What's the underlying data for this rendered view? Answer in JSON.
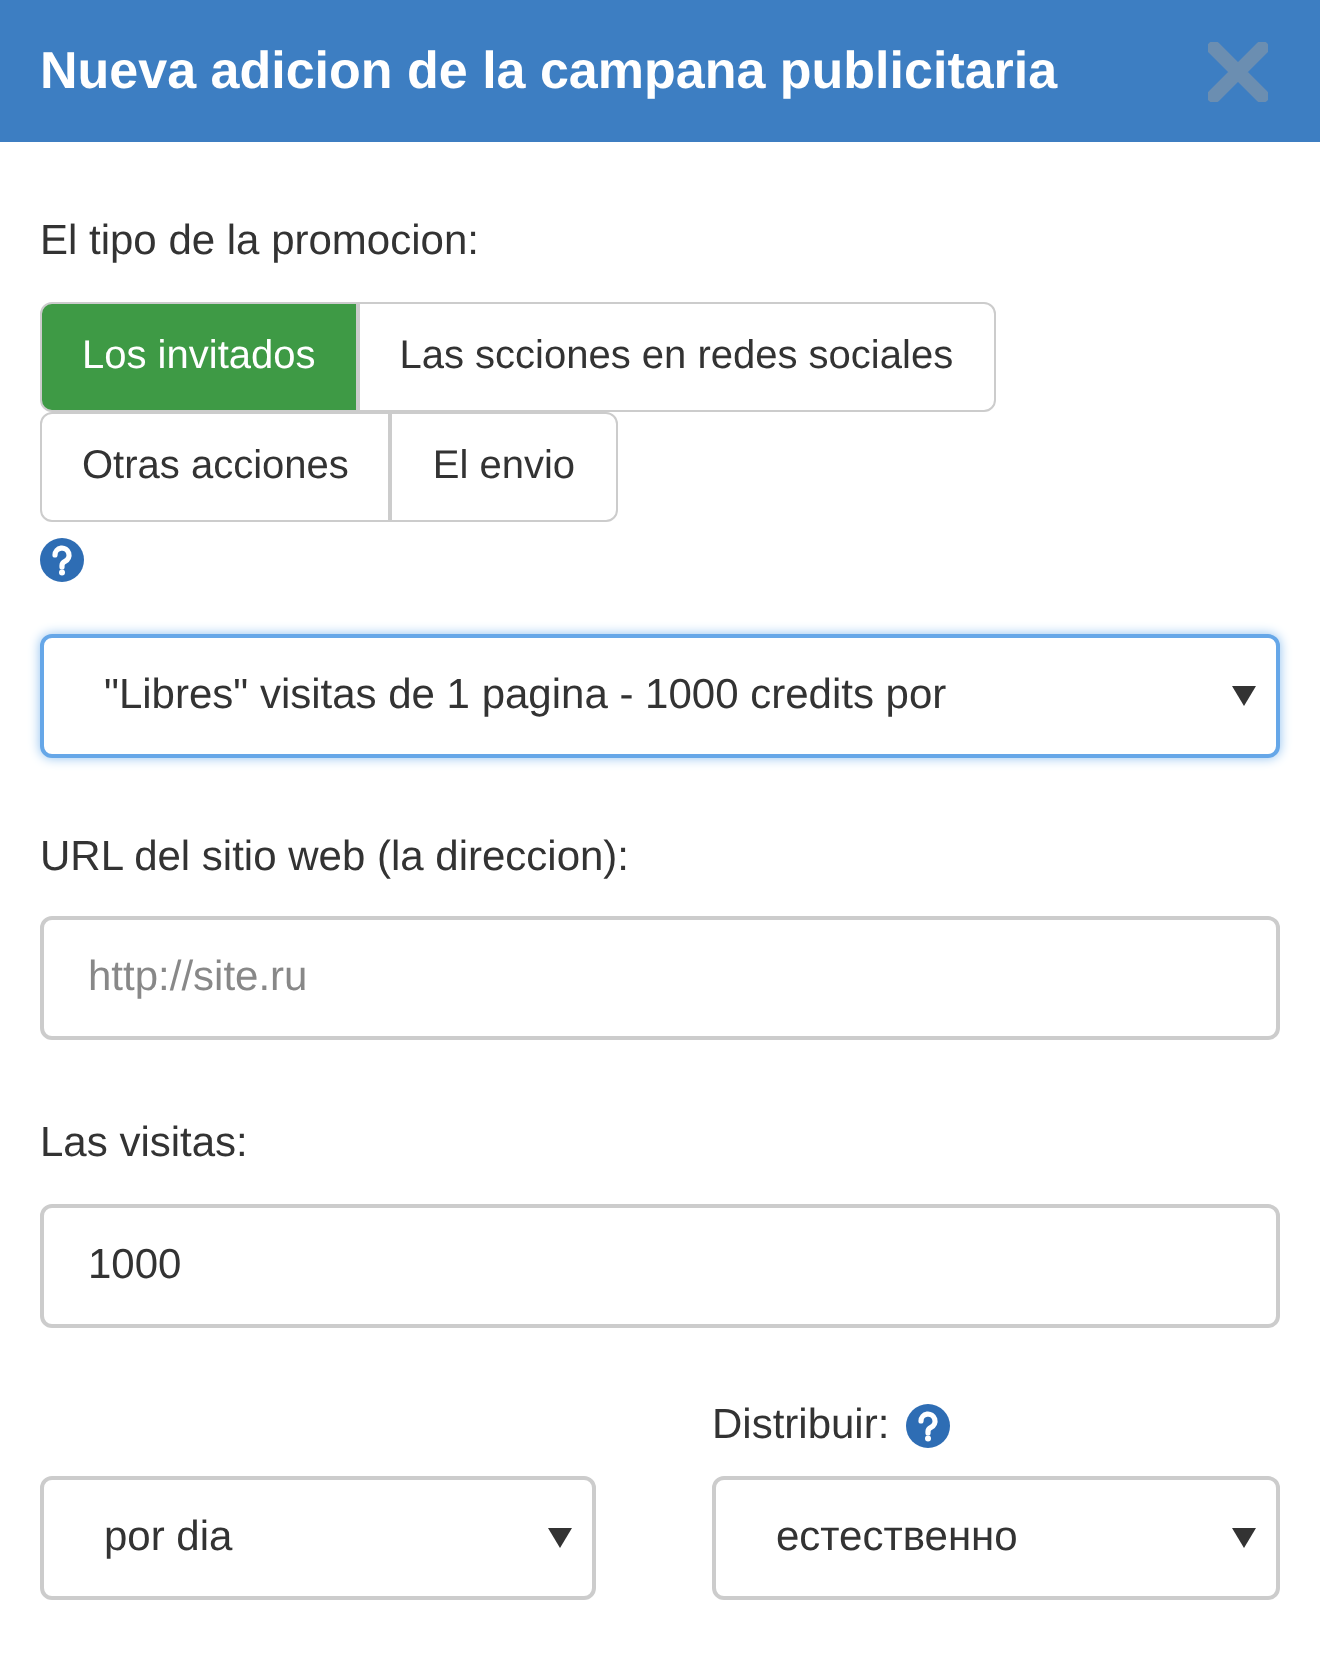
{
  "dialog": {
    "title": "Nueva adicion de la campana publicitaria"
  },
  "promotion_type": {
    "label": "El tipo de la promocion:",
    "options": [
      {
        "label": "Los invitados",
        "selected": true
      },
      {
        "label": "Las scciones en redes sociales",
        "selected": false
      },
      {
        "label": "Otras acciones",
        "selected": false
      },
      {
        "label": "El envio",
        "selected": false
      }
    ]
  },
  "package_select": {
    "value": "\"Libres\" visitas de 1 pagina - 1000 credits por",
    "focused": true
  },
  "url_field": {
    "label": "URL del sitio web (la direccion):",
    "placeholder": "http://site.ru"
  },
  "visits_field": {
    "label": "Las visitas:",
    "value": "1000"
  },
  "period_select": {
    "value": "por dia"
  },
  "distribute": {
    "label": "Distribuir:",
    "value": "естественно"
  }
}
